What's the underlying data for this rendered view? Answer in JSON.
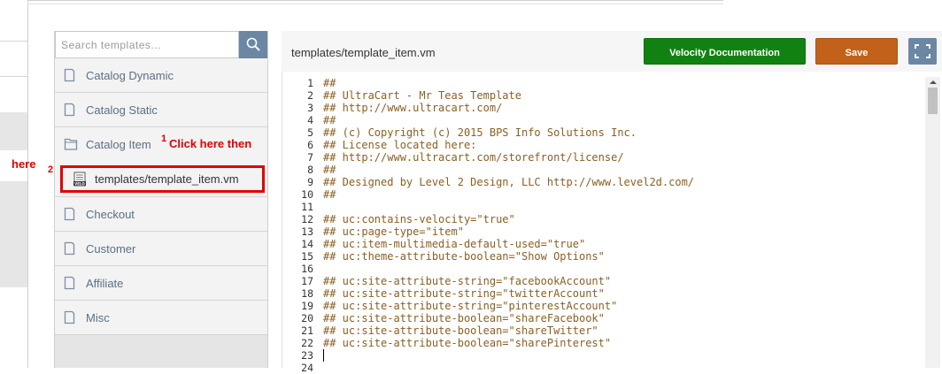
{
  "search": {
    "placeholder": "Search templates..."
  },
  "sidebar": {
    "items": [
      {
        "label": "Catalog Dynamic",
        "icon": "folder-icon"
      },
      {
        "label": "Catalog Static",
        "icon": "folder-icon"
      },
      {
        "label": "Catalog Item",
        "icon": "folder-open-icon"
      },
      {
        "label": "templates/template_item.vm",
        "icon": "velocity-file-icon"
      },
      {
        "label": "Checkout",
        "icon": "folder-icon"
      },
      {
        "label": "Customer",
        "icon": "folder-icon"
      },
      {
        "label": "Affiliate",
        "icon": "folder-icon"
      },
      {
        "label": "Misc",
        "icon": "folder-icon"
      }
    ]
  },
  "annotations": {
    "step1_number": "1",
    "step1_text": "Click  here then",
    "step2_number": "2",
    "step2_text": "here",
    "color": "#e00000"
  },
  "editor": {
    "file_title": "templates/template_item.vm",
    "velocity_docs_label": "Velocity Documentation",
    "save_label": "Save",
    "expand_icon": "expand-icon",
    "lines": [
      "##",
      "## UltraCart - Mr Teas Template",
      "## http://www.ultracart.com/",
      "##",
      "## (c) Copyright (c) 2015 BPS Info Solutions Inc.",
      "## License located here:",
      "## http://www.ultracart.com/storefront/license/",
      "##",
      "## Designed by Level 2 Design, LLC http://www.level2d.com/",
      "##",
      "",
      "## uc:contains-velocity=\"true\"",
      "## uc:page-type=\"item\"",
      "## uc:item-multimedia-default-used=\"true\"",
      "## uc:theme-attribute-boolean=\"Show Options\"",
      "",
      "## uc:site-attribute-string=\"facebookAccount\"",
      "## uc:site-attribute-string=\"twitterAccount\"",
      "## uc:site-attribute-string=\"pinterestAccount\"",
      "## uc:site-attribute-boolean=\"shareFacebook\"",
      "## uc:site-attribute-boolean=\"shareTwitter\"",
      "## uc:site-attribute-boolean=\"sharePinterest\"",
      "",
      ""
    ],
    "line_numbers": [
      "1",
      "2",
      "3",
      "4",
      "5",
      "6",
      "7",
      "8",
      "9",
      "10",
      "11",
      "12",
      "13",
      "14",
      "15",
      "16",
      "17",
      "18",
      "19",
      "20",
      "21",
      "22",
      "23",
      "24"
    ]
  },
  "colors": {
    "accent_blue": "#6b87a3",
    "velocity_green": "#118211",
    "save_orange": "#c2621a",
    "code_text": "#8a6023"
  }
}
